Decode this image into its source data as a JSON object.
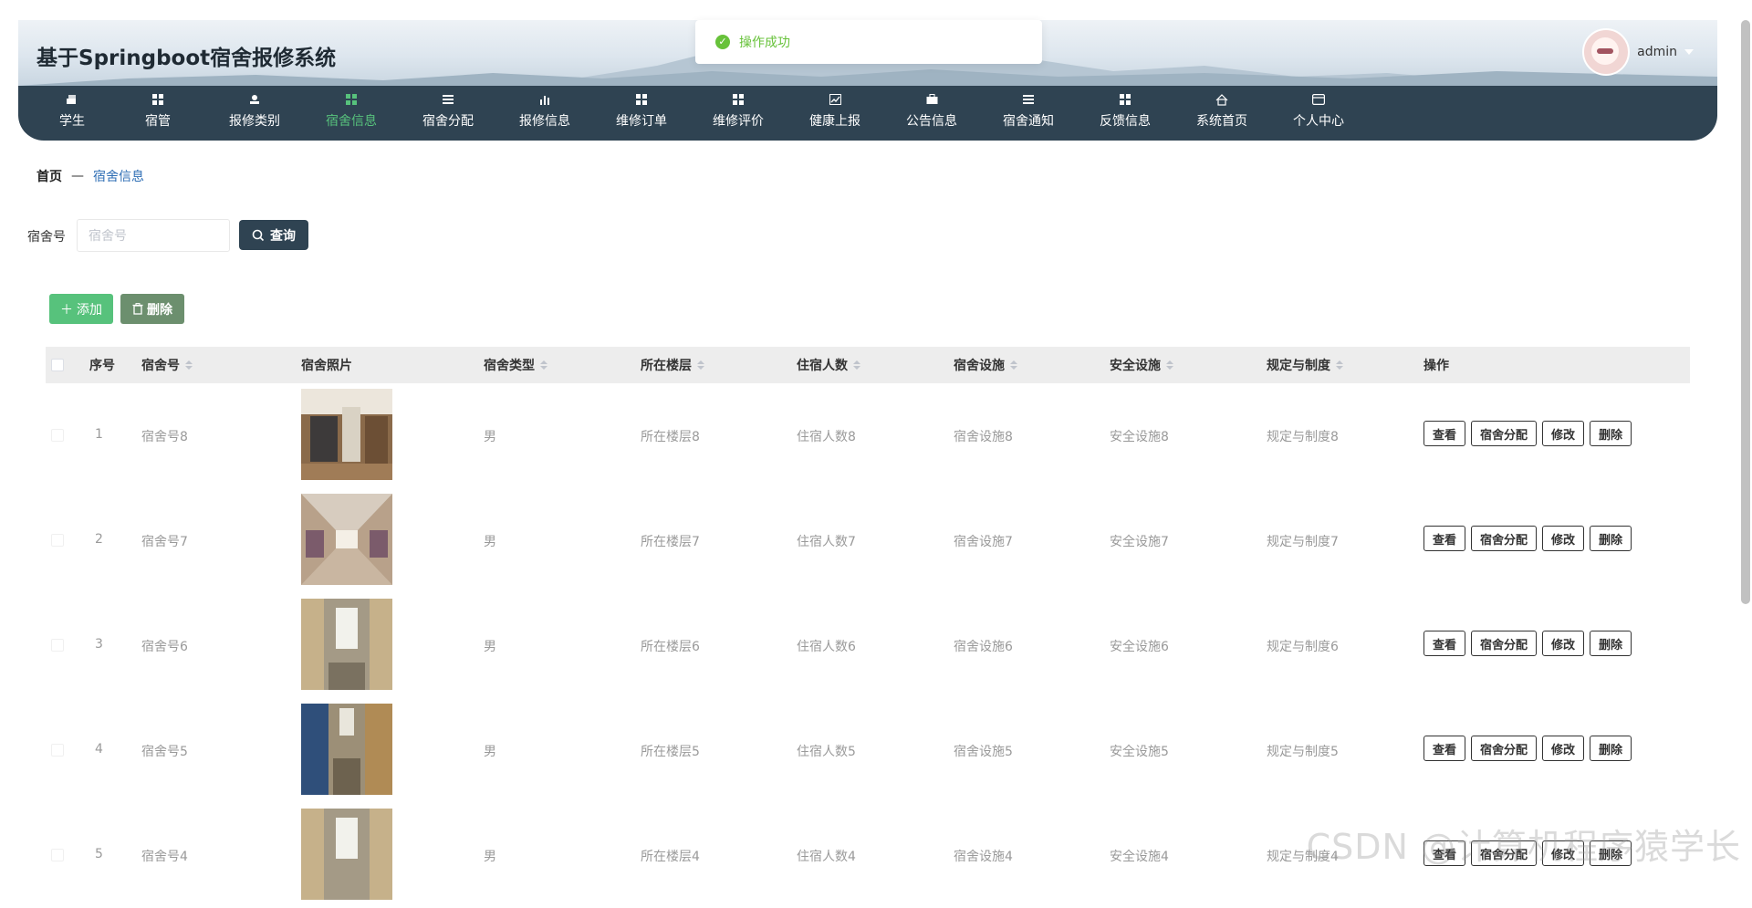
{
  "header": {
    "title": "基于Springboot宿舍报修系统",
    "user": "admin"
  },
  "toast": "操作成功",
  "nav": [
    {
      "label": "学生",
      "icon": "student-icon"
    },
    {
      "label": "宿管",
      "icon": "grid-icon"
    },
    {
      "label": "报修类别",
      "icon": "user-icon"
    },
    {
      "label": "宿舍信息",
      "icon": "grid-icon",
      "active": true
    },
    {
      "label": "宿舍分配",
      "icon": "list-icon"
    },
    {
      "label": "报修信息",
      "icon": "chart-icon"
    },
    {
      "label": "维修订单",
      "icon": "grid-icon"
    },
    {
      "label": "维修评价",
      "icon": "grid-icon"
    },
    {
      "label": "健康上报",
      "icon": "trend-icon"
    },
    {
      "label": "公告信息",
      "icon": "briefcase-icon"
    },
    {
      "label": "宿舍通知",
      "icon": "list-icon"
    },
    {
      "label": "反馈信息",
      "icon": "grid-icon"
    },
    {
      "label": "系统首页",
      "icon": "home-icon"
    },
    {
      "label": "个人中心",
      "icon": "card-icon"
    }
  ],
  "breadcrumb": {
    "home": "首页",
    "sep": "—",
    "current": "宿舍信息"
  },
  "search": {
    "label": "宿舍号",
    "placeholder": "宿舍号",
    "button": "查询"
  },
  "toolbar": {
    "add": "添加",
    "delete": "删除"
  },
  "table": {
    "columns": [
      "序号",
      "宿舍号",
      "宿舍照片",
      "宿舍类型",
      "所在楼层",
      "住宿人数",
      "宿舍设施",
      "安全设施",
      "规定与制度",
      "操作"
    ],
    "actions": [
      "查看",
      "宿舍分配",
      "修改",
      "删除"
    ],
    "rows": [
      {
        "no": "1",
        "room": "宿舍号8",
        "type": "男",
        "floor": "所在楼层8",
        "people": "住宿人数8",
        "facility": "宿舍设施8",
        "safety": "安全设施8",
        "rules": "规定与制度8"
      },
      {
        "no": "2",
        "room": "宿舍号7",
        "type": "男",
        "floor": "所在楼层7",
        "people": "住宿人数7",
        "facility": "宿舍设施7",
        "safety": "安全设施7",
        "rules": "规定与制度7"
      },
      {
        "no": "3",
        "room": "宿舍号6",
        "type": "男",
        "floor": "所在楼层6",
        "people": "住宿人数6",
        "facility": "宿舍设施6",
        "safety": "安全设施6",
        "rules": "规定与制度6"
      },
      {
        "no": "4",
        "room": "宿舍号5",
        "type": "男",
        "floor": "所在楼层5",
        "people": "住宿人数5",
        "facility": "宿舍设施5",
        "safety": "安全设施5",
        "rules": "规定与制度5"
      },
      {
        "no": "5",
        "room": "宿舍号4",
        "type": "男",
        "floor": "所在楼层4",
        "people": "住宿人数4",
        "facility": "宿舍设施4",
        "safety": "安全设施4",
        "rules": "规定与制度4"
      }
    ]
  },
  "watermark": "CSDN @计算机程序猿学长"
}
